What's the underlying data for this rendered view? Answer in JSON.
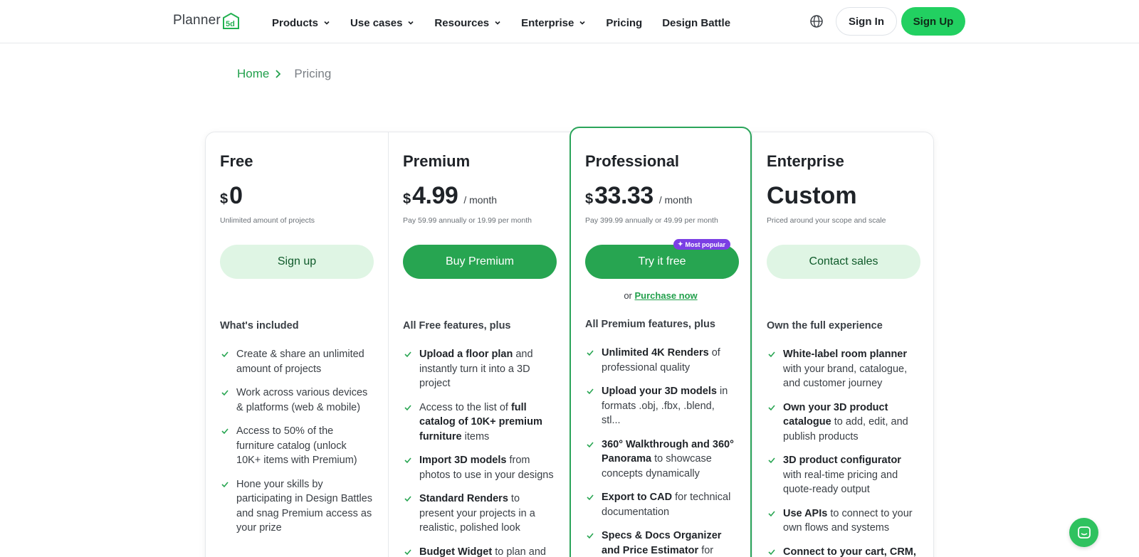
{
  "header": {
    "logo_text": "Planner",
    "logo_mark_text": "5d",
    "nav": [
      {
        "label": "Products",
        "dropdown": true
      },
      {
        "label": "Use cases",
        "dropdown": true
      },
      {
        "label": "Resources",
        "dropdown": true
      },
      {
        "label": "Enterprise",
        "dropdown": true
      },
      {
        "label": "Pricing",
        "dropdown": false
      },
      {
        "label": "Design Battle",
        "dropdown": false
      }
    ],
    "globe_icon": "globe-icon",
    "signin_label": "Sign In",
    "signup_label": "Sign Up"
  },
  "breadcrumb": {
    "home": "Home",
    "current": "Pricing"
  },
  "colors": {
    "accent": "#22d061",
    "accent_dark": "#27a551",
    "accent_light": "#dff5e4",
    "badge": "#7b3fe4"
  },
  "plans": [
    {
      "name": "Free",
      "currency": "$",
      "price": "0",
      "per": "",
      "note": "Unlimited amount of projects",
      "cta": "Sign up",
      "included": "What's included",
      "features": [
        {
          "pre": "Create & share an unlimited amount of projects",
          "bold": "",
          "post": ""
        },
        {
          "pre": "Work across various devices & platforms (web & mobile)",
          "bold": "",
          "post": ""
        },
        {
          "pre": "Access to 50% of the furniture catalog (unlock 10K+ items with Premium)",
          "bold": "",
          "post": ""
        },
        {
          "pre": "Hone your skills by participating in Design Battles and snag Premium access as your prize",
          "bold": "",
          "post": ""
        }
      ]
    },
    {
      "name": "Premium",
      "currency": "$",
      "price": "4.99",
      "per": "/  month",
      "note": "Pay 59.99 annually or 19.99 per month",
      "cta": "Buy Premium",
      "included": "All Free features, plus",
      "features": [
        {
          "pre": "",
          "bold": "Upload a floor plan",
          "post": " and instantly turn it into a 3D project"
        },
        {
          "pre": "Access to the list of ",
          "bold": "full catalog of 10K+ premium furniture",
          "post": " items"
        },
        {
          "pre": "",
          "bold": "Import 3D models",
          "post": " from photos to use in your designs"
        },
        {
          "pre": "",
          "bold": "Standard Renders",
          "post": " to present your projects in a realistic, polished look"
        },
        {
          "pre": "",
          "bold": "Budget Widget",
          "post": " to plan and"
        }
      ]
    },
    {
      "name": "Professional",
      "currency": "$",
      "price": "33.33",
      "per": "/  month",
      "note": "Pay 399.99 annually or 49.99 per month",
      "cta": "Try it free",
      "badge": "Most popular",
      "or_text": "or",
      "purchase_link": "Purchase now",
      "included": "All Premium features, plus",
      "features": [
        {
          "pre": "",
          "bold": "Unlimited 4K Renders",
          "post": " of professional quality"
        },
        {
          "pre": "",
          "bold": "Upload your 3D models",
          "post": " in formats .obj, .fbx, .blend, stl..."
        },
        {
          "pre": "",
          "bold": "360° Walkthrough and 360° Panorama",
          "post": " to showcase concepts dynamically"
        },
        {
          "pre": "",
          "bold": "Export to CAD",
          "post": " for technical documentation"
        },
        {
          "pre": "",
          "bold": "Specs & Docs Organizer and Price Estimator",
          "post": " for professional workflows"
        }
      ]
    },
    {
      "name": "Enterprise",
      "custom_price": "Custom",
      "note": "Priced around your scope and scale",
      "cta": "Contact sales",
      "included": "Own the full experience",
      "features": [
        {
          "pre": "",
          "bold": "White-label room planner",
          "post": " with your brand, catalogue, and customer journey"
        },
        {
          "pre": "",
          "bold": "Own your 3D product catalogue",
          "post": " to add, edit, and publish products"
        },
        {
          "pre": "",
          "bold": "3D product configurator",
          "post": " with real-time pricing and quote-ready output"
        },
        {
          "pre": "",
          "bold": "Use APIs",
          "post": " to connect to your own flows and systems"
        },
        {
          "pre": "",
          "bold": "Connect to your cart, CRM,",
          "post": ""
        }
      ]
    }
  ],
  "chat_icon": "chat-icon"
}
